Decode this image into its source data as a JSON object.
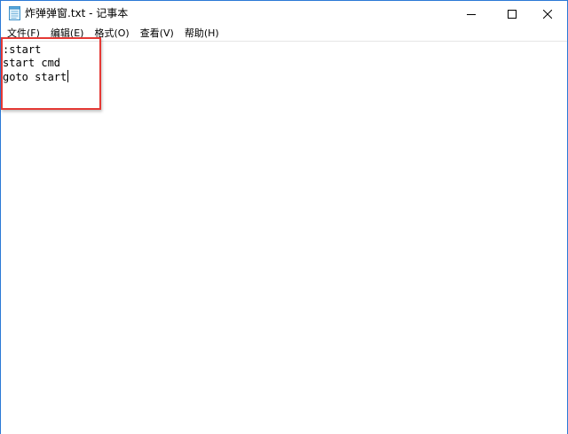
{
  "window": {
    "title": "炸弹弹窗.txt - 记事本",
    "border_color": "#2b79d6"
  },
  "titlebar": {
    "icon": "notepad-icon",
    "buttons": {
      "minimize": "minimize-icon",
      "maximize": "maximize-icon",
      "close": "close-icon"
    }
  },
  "menu": {
    "items": [
      {
        "label": "文件(F)"
      },
      {
        "label": "编辑(E)"
      },
      {
        "label": "格式(O)"
      },
      {
        "label": "查看(V)"
      },
      {
        "label": "帮助(H)"
      }
    ]
  },
  "editor": {
    "lines": [
      ":start",
      "start cmd",
      "goto start"
    ]
  },
  "annotation": {
    "color": "#e53935"
  }
}
